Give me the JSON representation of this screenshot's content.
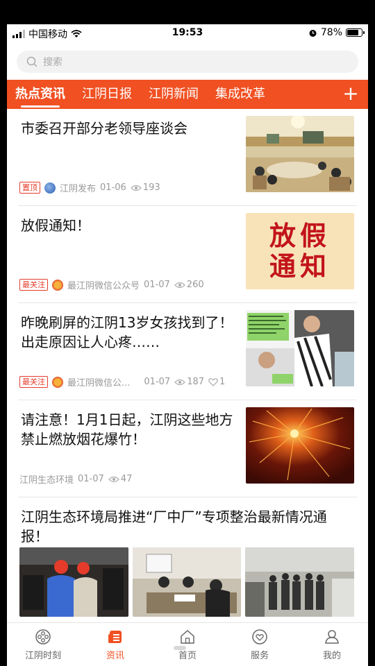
{
  "status": {
    "carrier": "中国移动",
    "time": "19:53",
    "battery": "78%"
  },
  "search": {
    "placeholder": "搜索"
  },
  "tabs": [
    {
      "label": "热点资讯"
    },
    {
      "label": "江阴日报"
    },
    {
      "label": "江阴新闻"
    },
    {
      "label": "集成改革"
    }
  ],
  "tab_add": "+",
  "articles": [
    {
      "title": "市委召开部分老领导座谈会",
      "tag": "置顶",
      "source": "江阴发布",
      "date": "01-06",
      "views": "193"
    },
    {
      "title": "放假通知！",
      "tag": "最关注",
      "source": "最江阴微信公众号",
      "date": "01-07",
      "views": "260",
      "thumb_text": "放假\n通知"
    },
    {
      "title": "昨晚刷屏的江阴13岁女孩找到了！出走原因让人心疼……",
      "tag": "最关注",
      "source": "最江阴微信公...",
      "date": "01-07",
      "views": "187",
      "likes": "1"
    },
    {
      "title": "请注意！1月1日起，江阴这些地方禁止燃放烟花爆竹！",
      "source": "江阴生态环境",
      "date": "01-07",
      "views": "47"
    },
    {
      "title": "江阴生态环境局推进“厂中厂”专项整治最新情况通报！"
    }
  ],
  "bottom_nav": [
    {
      "label": "江阴时刻",
      "icon": "film-reel-icon"
    },
    {
      "label": "资讯",
      "icon": "news-icon"
    },
    {
      "label": "首页",
      "icon": "home-icon"
    },
    {
      "label": "服务",
      "icon": "service-icon"
    },
    {
      "label": "我的",
      "icon": "user-icon"
    }
  ],
  "colors": {
    "accent": "#f05022",
    "tag_red": "#e53b2b"
  }
}
